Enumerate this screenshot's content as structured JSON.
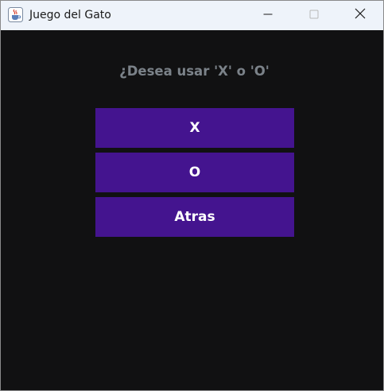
{
  "window": {
    "title": "Juego del Gato",
    "icons": {
      "app": "java-cup-icon",
      "minimize": "minimize-icon",
      "maximize": "maximize-icon",
      "close": "close-icon"
    }
  },
  "main": {
    "prompt": "¿Desea usar 'X' o 'O'",
    "buttons": {
      "x_label": "X",
      "o_label": "O",
      "back_label": "Atras"
    }
  },
  "colors": {
    "background": "#111112",
    "button": "#44148f",
    "prompt_text": "#7b8289",
    "titlebar": "#eef3fa"
  }
}
